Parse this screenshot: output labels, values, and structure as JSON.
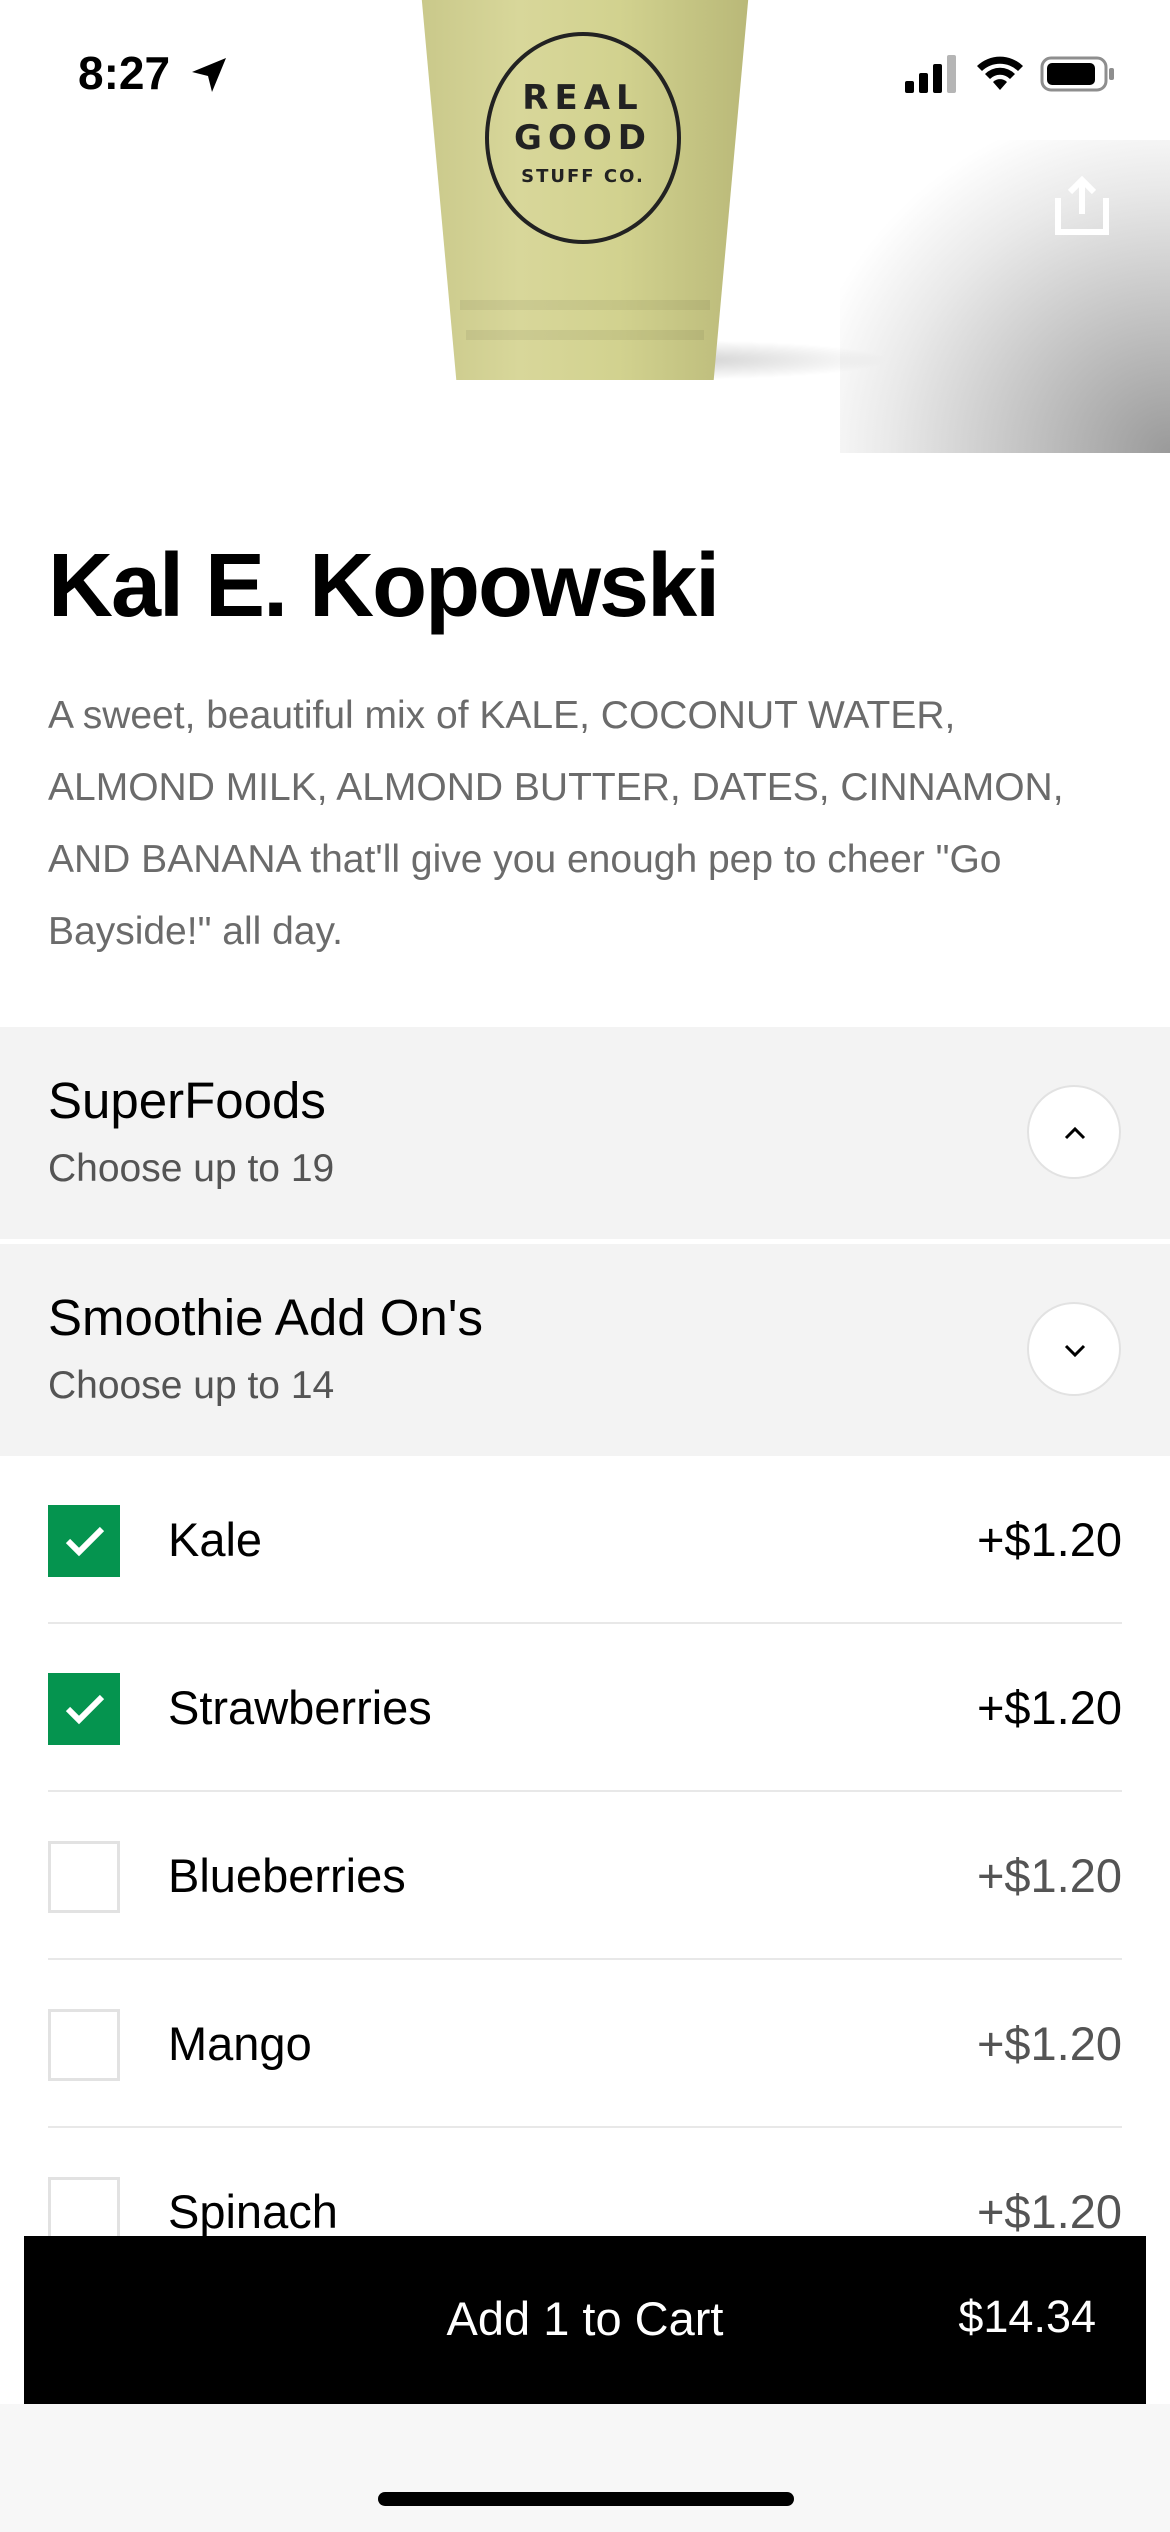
{
  "status_bar": {
    "time": "8:27",
    "icons": [
      "location-arrow-icon",
      "signal-icon",
      "wifi-icon",
      "battery-icon"
    ]
  },
  "hero": {
    "logo_line1": "REAL",
    "logo_line2": "GOOD",
    "logo_line3": "STUFF CO.",
    "share_icon": "share-icon"
  },
  "item": {
    "title": "Kal E. Kopowski",
    "description": "A sweet, beautiful mix of KALE, COCONUT WATER, ALMOND MILK, ALMOND BUTTER, DATES, CINNAMON, AND BANANA that'll give you enough pep to cheer \"Go Bayside!\" all day."
  },
  "groups": [
    {
      "name": "SuperFoods",
      "subtitle": "Choose up to 19",
      "state": "collapsed",
      "icon": "chevron-up-icon"
    },
    {
      "name": "Smoothie Add On's",
      "subtitle": "Choose up to 14",
      "state": "expanded",
      "icon": "chevron-down-icon"
    }
  ],
  "options": [
    {
      "name": "Kale",
      "price": "+$1.20",
      "checked": true
    },
    {
      "name": "Strawberries",
      "price": "+$1.20",
      "checked": true
    },
    {
      "name": "Blueberries",
      "price": "+$1.20",
      "checked": false
    },
    {
      "name": "Mango",
      "price": "+$1.20",
      "checked": false
    },
    {
      "name": "Spinach",
      "price": "+$1.20",
      "checked": false
    }
  ],
  "cart": {
    "label": "Add 1 to Cart",
    "total": "$14.34"
  },
  "colors": {
    "check_green": "#05944f",
    "group_bg": "#f3f3f3",
    "cart_bg": "#000000",
    "muted_text": "#6b6b6b"
  }
}
